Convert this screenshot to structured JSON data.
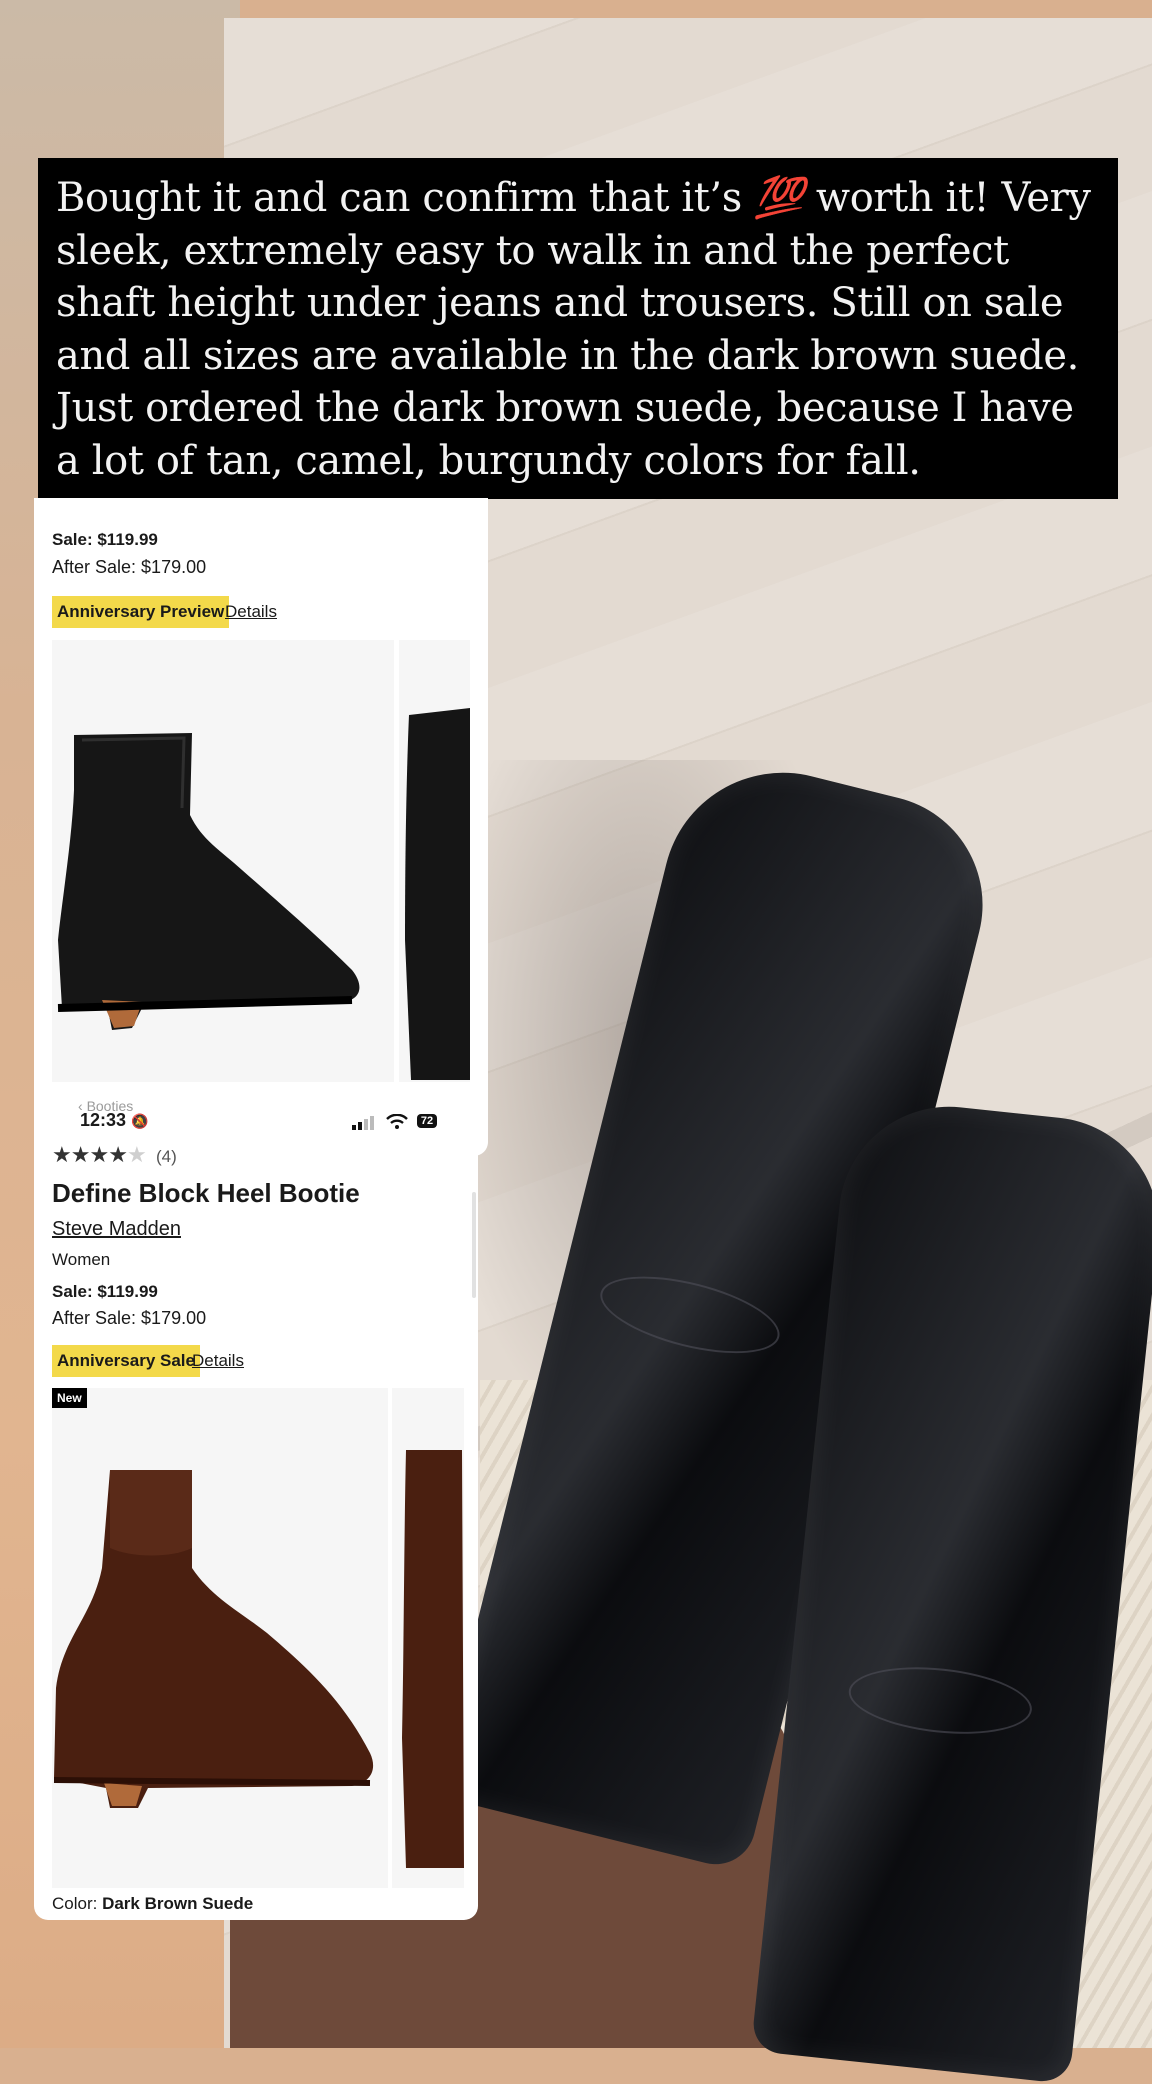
{
  "caption": {
    "before_emoji": "Bought it and can confirm that it’s ",
    "emoji": "💯",
    "after_emoji": " worth it! Very sleek, extremely easy to walk in and the perfect shaft height under jeans and trousers. Still on sale and all sizes are available in the dark brown suede. Just ordered the dark brown suede, because I have a lot of tan, camel, burgundy colors for fall."
  },
  "top_card": {
    "sale": "Sale: $119.99",
    "after_sale": "After Sale: $179.00",
    "badge": "Anniversary Preview",
    "details": "Details",
    "image_main_icon": "black-leather-boot-icon",
    "image_side_icon": "black-leather-boot-side-icon"
  },
  "status_bar": {
    "time": "12:33",
    "breadcrumb": "Booties",
    "battery": "72"
  },
  "product": {
    "rating_count": "(4)",
    "stars_filled": 4,
    "stars_total": 5,
    "title": "Define Block Heel Bootie",
    "brand": "Steve Madden",
    "gender": "Women",
    "sale": "Sale: $119.99",
    "after_sale": "After Sale: $179.00",
    "badge": "Anniversary Sale",
    "details": "Details",
    "new_badge": "New",
    "color_label": "Color: ",
    "color_value": "Dark Brown Suede",
    "image_main_icon": "brown-suede-boot-icon",
    "image_side_icon": "brown-suede-boot-side-icon"
  }
}
